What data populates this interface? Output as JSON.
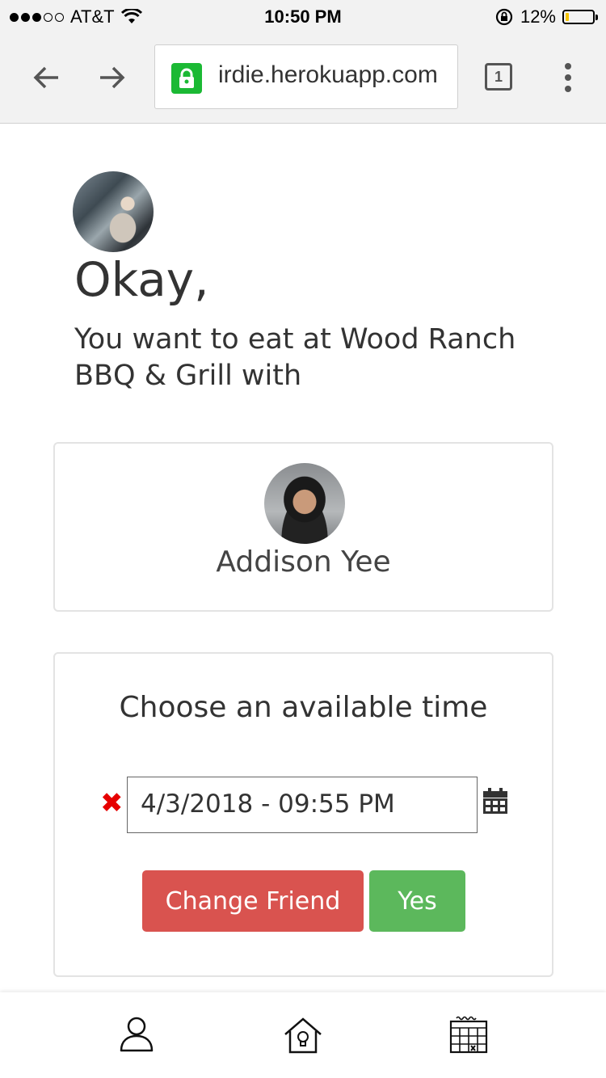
{
  "status_bar": {
    "carrier": "AT&T",
    "time": "10:50 PM",
    "battery_percent": "12%",
    "battery_level": 0.12,
    "signal_bars_filled": 3,
    "signal_bars_total": 5
  },
  "browser": {
    "url": "irdie.herokuapp.com",
    "tab_count": "1",
    "lock_color": "#1bb934"
  },
  "content": {
    "heading": "Okay,",
    "subtext": "You want to eat at Wood Ranch BBQ & Grill with",
    "friend": {
      "name": "Addison Yee"
    },
    "time_card": {
      "title": "Choose an available time",
      "datetime_value": "4/3/2018 - 09:55 PM",
      "clear_icon": "✖",
      "buttons": {
        "change_friend": "Change Friend",
        "yes": "Yes"
      }
    }
  },
  "colors": {
    "danger": "#d9534f",
    "success": "#5cb85c",
    "clear_red": "#e60000"
  },
  "bottom_nav": {
    "items": [
      {
        "icon": "profile-icon"
      },
      {
        "icon": "home-icon"
      },
      {
        "icon": "calendar-icon"
      }
    ]
  }
}
